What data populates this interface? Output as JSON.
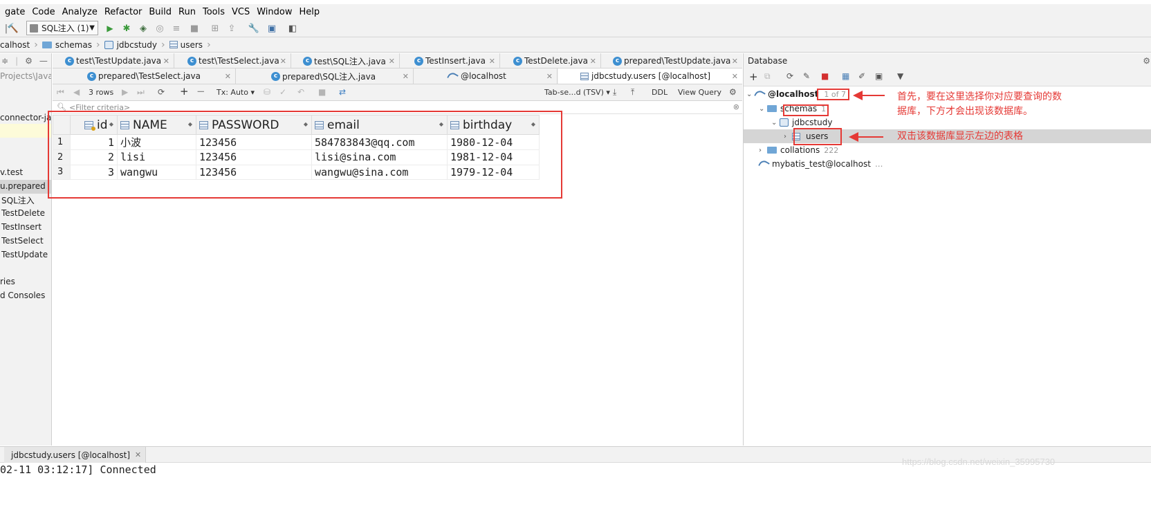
{
  "menu": [
    "gate",
    "Code",
    "Analyze",
    "Refactor",
    "Build",
    "Run",
    "Tools",
    "VCS",
    "Window",
    "Help"
  ],
  "run_config": "SQL注入 (1)",
  "breadcrumb": [
    "calhost",
    "schemas",
    "jdbcstudy",
    "users"
  ],
  "left_panel": {
    "path": "Projects\\JavaW",
    "items": [
      "connector-jav",
      "v.test",
      "u.prepared",
      "SQL注入",
      "TestDelete",
      "TestInsert",
      "TestSelect",
      "TestUpdate",
      "ries",
      "d Consoles"
    ]
  },
  "tabs_row1": [
    "test\\TestUpdate.java",
    "test\\TestSelect.java",
    "test\\SQL注入.java",
    "TestInsert.java",
    "TestDelete.java",
    "prepared\\TestUpdate.java"
  ],
  "tabs_row2": [
    "prepared\\TestSelect.java",
    "prepared\\SQL注入.java",
    "@localhost",
    "jdbcstudy.users [@localhost]"
  ],
  "grid_toolbar": {
    "rows": "3 rows",
    "tx": "Tx: Auto",
    "export_format": "Tab-se...d (TSV)",
    "ddl": "DDL",
    "view_query": "View Query"
  },
  "filter_placeholder": "<Filter criteria>",
  "table": {
    "columns": [
      "id",
      "NAME",
      "PASSWORD",
      "email",
      "birthday"
    ],
    "rows": [
      {
        "n": "1",
        "id": "1",
        "name": "小波",
        "password": "123456",
        "email": "584783843@qq.com",
        "birthday": "1980-12-04"
      },
      {
        "n": "2",
        "id": "2",
        "name": "lisi",
        "password": "123456",
        "email": "lisi@sina.com",
        "birthday": "1981-12-04"
      },
      {
        "n": "3",
        "id": "3",
        "name": "wangwu",
        "password": "123456",
        "email": "wangwu@sina.com",
        "birthday": "1979-12-04"
      }
    ]
  },
  "db_panel": {
    "title": "Database",
    "host": "@localhost",
    "host_count": "1 of 7",
    "schemas": "schemas",
    "schemas_count": "1",
    "jdbcstudy": "jdbcstudy",
    "users": "users",
    "collations": "collations",
    "collations_count": "222",
    "mybatis": "mybatis_test@localhost",
    "mybatis_more": "..."
  },
  "annotations": {
    "note1_line1": "首先，要在这里选择你对应要查询的数",
    "note1_line2": "据库，下方才会出现该数据库。",
    "note2": "双击该数据库显示左边的表格"
  },
  "bottom_tab": "jdbcstudy.users [@localhost]",
  "console_line": "02-11 03:12:17] Connected",
  "watermark": "https://blog.csdn.net/weixin_35995730",
  "colors": {
    "accent_red": "#e53935",
    "panel_bg": "#f2f2f2",
    "icon_blue": "#3d8fd1"
  }
}
